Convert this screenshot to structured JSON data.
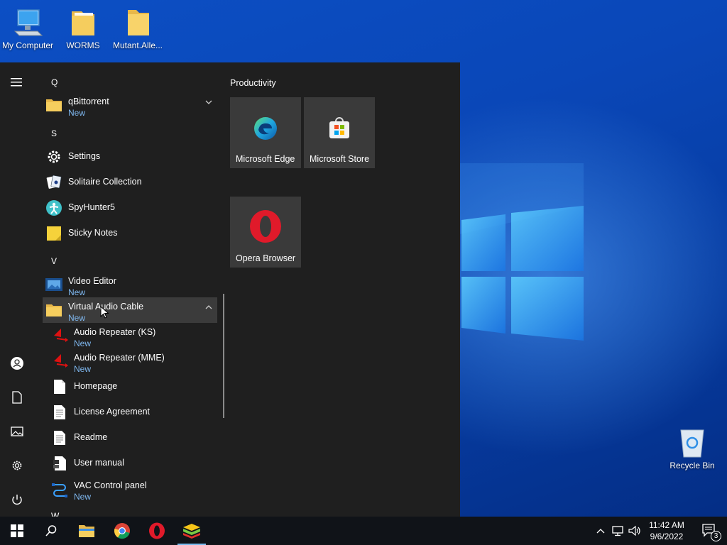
{
  "desktop": {
    "icons": [
      {
        "label": "My Computer",
        "icon": "computer-icon"
      },
      {
        "label": "WORMS",
        "icon": "folder-icon"
      },
      {
        "label": "Mutant.Alle...",
        "icon": "folder-icon"
      },
      {
        "label": "Recycle Bin",
        "icon": "recycle-bin-icon"
      }
    ]
  },
  "start_menu": {
    "rail": [
      "hamburger-menu-icon",
      "user-icon",
      "documents-icon",
      "pictures-icon",
      "settings-icon",
      "power-icon"
    ],
    "letters": {
      "q": "Q",
      "s": "S",
      "v": "V",
      "w": "W"
    },
    "apps": [
      {
        "name": "qBittorrent",
        "badge": "New",
        "icon": "folder-icon"
      },
      {
        "name": "Settings",
        "icon": "gear-icon"
      },
      {
        "name": "Solitaire Collection",
        "icon": "cards-icon"
      },
      {
        "name": "SpyHunter5",
        "icon": "spyhunter-icon"
      },
      {
        "name": "Sticky Notes",
        "icon": "sticky-notes-icon"
      },
      {
        "name": "Video Editor",
        "badge": "New",
        "icon": "video-editor-icon"
      },
      {
        "name": "Virtual Audio Cable",
        "badge": "New",
        "icon": "folder-icon"
      },
      {
        "name": "Audio Repeater (KS)",
        "badge": "New",
        "icon": "audio-repeater-icon"
      },
      {
        "name": "Audio Repeater (MME)",
        "badge": "New",
        "icon": "audio-repeater-icon"
      },
      {
        "name": "Homepage",
        "icon": "document-icon"
      },
      {
        "name": "License Agreement",
        "icon": "text-document-icon"
      },
      {
        "name": "Readme",
        "icon": "text-document-icon"
      },
      {
        "name": "User manual",
        "icon": "manual-icon"
      },
      {
        "name": "VAC Control panel",
        "badge": "New",
        "icon": "vac-control-icon"
      }
    ],
    "tiles_group": "Productivity",
    "tiles": [
      {
        "label": "Microsoft Edge",
        "icon": "edge-icon"
      },
      {
        "label": "Microsoft Store",
        "icon": "store-icon"
      },
      {
        "label": "Opera Browser",
        "icon": "opera-icon"
      }
    ]
  },
  "taskbar": {
    "buttons": [
      "start-icon",
      "search-icon",
      "file-explorer-icon",
      "chrome-icon",
      "opera-icon",
      "bluestacks-icon"
    ],
    "tray": [
      "chevron-up-icon",
      "network-icon",
      "volume-icon"
    ],
    "time": "11:42 AM",
    "date": "9/6/2022",
    "notification_count": "3"
  },
  "colors": {
    "accent": "#76b9ed",
    "badge": "#7fb8f0",
    "menu_bg": "#1f1f1f",
    "tile_bg": "#3a3a3a"
  }
}
